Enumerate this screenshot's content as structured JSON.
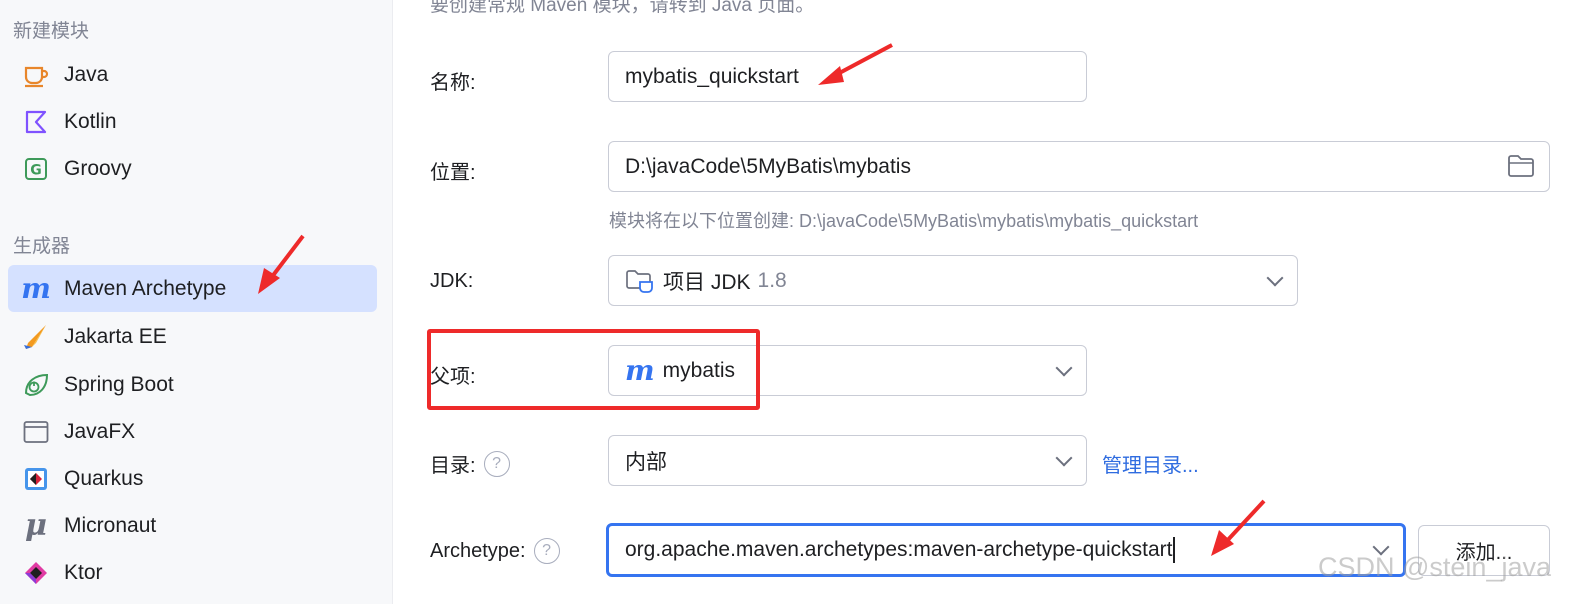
{
  "sidebar": {
    "sections": [
      {
        "header": "新建模块",
        "items": [
          {
            "label": "Java",
            "icon": "java-cup-icon"
          },
          {
            "label": "Kotlin",
            "icon": "kotlin-icon"
          },
          {
            "label": "Groovy",
            "icon": "groovy-icon"
          }
        ]
      },
      {
        "header": "生成器",
        "items": [
          {
            "label": "Maven Archetype",
            "icon": "maven-icon",
            "selected": true
          },
          {
            "label": "Jakarta EE",
            "icon": "jakarta-icon"
          },
          {
            "label": "Spring Boot",
            "icon": "spring-boot-icon"
          },
          {
            "label": "JavaFX",
            "icon": "javafx-icon"
          },
          {
            "label": "Quarkus",
            "icon": "quarkus-icon"
          },
          {
            "label": "Micronaut",
            "icon": "micronaut-icon"
          },
          {
            "label": "Ktor",
            "icon": "ktor-icon"
          }
        ]
      }
    ]
  },
  "main": {
    "top_hint": "要创建常规 Maven 模块，请转到 Java 页面。",
    "name": {
      "label": "名称:",
      "value": "mybatis_quickstart"
    },
    "location": {
      "label": "位置:",
      "value": "D:\\javaCode\\5MyBatis\\mybatis",
      "hint": "模块将在以下位置创建: D:\\javaCode\\5MyBatis\\mybatis\\mybatis_quickstart"
    },
    "jdk": {
      "label": "JDK:",
      "value": "项目 JDK",
      "version": "1.8"
    },
    "parent": {
      "label": "父项:",
      "value": "mybatis",
      "icon_glyph": "m"
    },
    "catalog": {
      "label": "目录:",
      "value": "内部",
      "link": "管理目录..."
    },
    "archetype": {
      "label": "Archetype:",
      "value": "org.apache.maven.archetypes:maven-archetype-quickstart",
      "add_button": "添加..."
    }
  },
  "watermark": "CSDN @stein_java",
  "colors": {
    "accent": "#3574f0",
    "selected_bg": "#d5e1ff",
    "annotation_red": "#ee2a2a"
  }
}
